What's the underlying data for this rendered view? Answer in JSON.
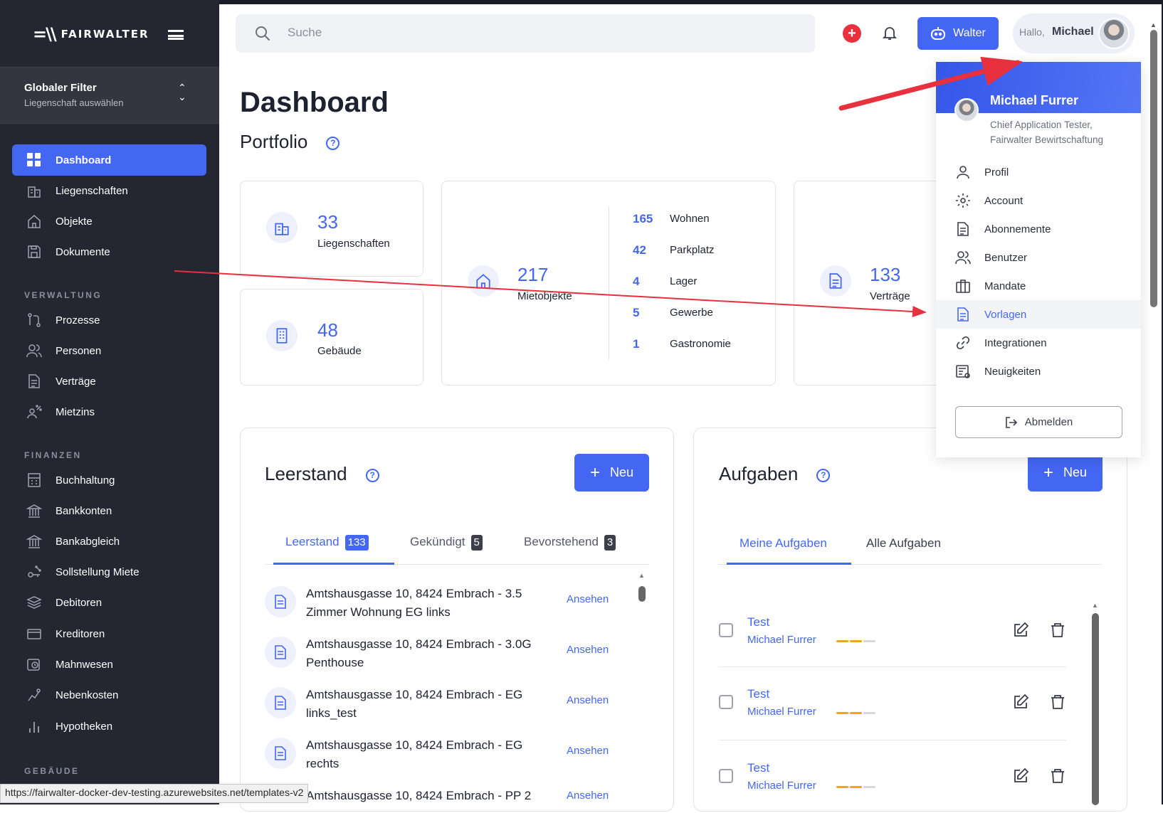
{
  "sidebar": {
    "logo": "FAIRWALTER",
    "global_filter": {
      "title": "Globaler Filter",
      "subtitle": "Liegenschaft auswählen"
    },
    "items": [
      {
        "label": "Dashboard",
        "icon": "grid-icon"
      },
      {
        "label": "Liegenschaften",
        "icon": "buildings-icon"
      },
      {
        "label": "Objekte",
        "icon": "home-icon"
      },
      {
        "label": "Dokumente",
        "icon": "save-icon"
      }
    ],
    "section_verwaltung": "VERWALTUNG",
    "verwaltung": [
      {
        "label": "Prozesse",
        "icon": "process-icon"
      },
      {
        "label": "Personen",
        "icon": "users-icon"
      },
      {
        "label": "Verträge",
        "icon": "document-icon"
      },
      {
        "label": "Mietzins",
        "icon": "percent-user-icon"
      }
    ],
    "section_finanzen": "FINANZEN",
    "finanzen": [
      {
        "label": "Buchhaltung",
        "icon": "calculator-icon"
      },
      {
        "label": "Bankkonten",
        "icon": "bank-icon"
      },
      {
        "label": "Bankabgleich",
        "icon": "bank-icon"
      },
      {
        "label": "Sollstellung Miete",
        "icon": "keys-icon"
      },
      {
        "label": "Debitoren",
        "icon": "stack-icon"
      },
      {
        "label": "Kreditoren",
        "icon": "card-icon"
      },
      {
        "label": "Mahnwesen",
        "icon": "alarm-icon"
      },
      {
        "label": "Nebenkosten",
        "icon": "chart-icon"
      },
      {
        "label": "Hypotheken",
        "icon": "bars-icon"
      }
    ],
    "section_gebaeude": "GEBÄUDE"
  },
  "topbar": {
    "search_placeholder": "Suche",
    "walter_label": "Walter",
    "hallo": "Hallo,",
    "user_first": "Michael"
  },
  "main": {
    "title": "Dashboard",
    "subtitle": "Portfolio",
    "kpis": {
      "liegenschaften": {
        "value": "33",
        "label": "Liegenschaften"
      },
      "gebaeude": {
        "value": "48",
        "label": "Gebäude"
      },
      "mietobjekte": {
        "value": "217",
        "label": "Mietobjekte"
      },
      "vertraege": {
        "value": "133",
        "label": "Verträge"
      }
    },
    "breakdown": [
      {
        "value": "165",
        "label": "Wohnen"
      },
      {
        "value": "42",
        "label": "Parkplatz"
      },
      {
        "value": "4",
        "label": "Lager"
      },
      {
        "value": "5",
        "label": "Gewerbe"
      },
      {
        "value": "1",
        "label": "Gastronomie"
      }
    ]
  },
  "leerstand": {
    "title": "Leerstand",
    "new_label": "Neu",
    "tabs": [
      {
        "label": "Leerstand",
        "count": "133"
      },
      {
        "label": "Gekündigt",
        "count": "5"
      },
      {
        "label": "Bevorstehend",
        "count": "3"
      }
    ],
    "rows": [
      {
        "text": "Amtshausgasse 10, 8424 Embrach - 3.5 Zimmer Wohnung EG links",
        "link": "Ansehen"
      },
      {
        "text": "Amtshausgasse 10, 8424 Embrach - 3.0G Penthouse",
        "link": "Ansehen"
      },
      {
        "text": "Amtshausgasse 10, 8424 Embrach - EG links_test",
        "link": "Ansehen"
      },
      {
        "text": "Amtshausgasse 10, 8424 Embrach - EG rechts",
        "link": "Ansehen"
      },
      {
        "text": "Amtshausgasse 10, 8424 Embrach - PP 2",
        "link": "Ansehen"
      }
    ]
  },
  "aufgaben": {
    "title": "Aufgaben",
    "new_label": "Neu",
    "tabs": [
      "Meine Aufgaben",
      "Alle Aufgaben"
    ],
    "tasks": [
      {
        "title": "Test",
        "assignee": "Michael Furrer",
        "priority": 2
      },
      {
        "title": "Test",
        "assignee": "Michael Furrer",
        "priority": 2
      },
      {
        "title": "Test",
        "assignee": "Michael Furrer",
        "priority": 2
      }
    ]
  },
  "user_menu": {
    "name": "Michael Furrer",
    "role": "Chief Application Tester, Fairwalter Bewirtschaftung",
    "items": [
      {
        "label": "Profil",
        "icon": "user-icon"
      },
      {
        "label": "Account",
        "icon": "gear-icon"
      },
      {
        "label": "Abonnemente",
        "icon": "document-icon"
      },
      {
        "label": "Benutzer",
        "icon": "users-icon"
      },
      {
        "label": "Mandate",
        "icon": "briefcase-icon"
      },
      {
        "label": "Vorlagen",
        "icon": "document-icon"
      },
      {
        "label": "Integrationen",
        "icon": "link-icon"
      },
      {
        "label": "Neuigkeiten",
        "icon": "news-icon"
      }
    ],
    "logout": "Abmelden"
  },
  "status_url": "https://fairwalter-docker-dev-testing.azurewebsites.net/templates-v2",
  "colors": {
    "accent": "#4467f3",
    "sidebar": "#242732",
    "danger": "#e8313f",
    "priority": "#f0a51f",
    "annotation_arrow": "#e8313f"
  }
}
